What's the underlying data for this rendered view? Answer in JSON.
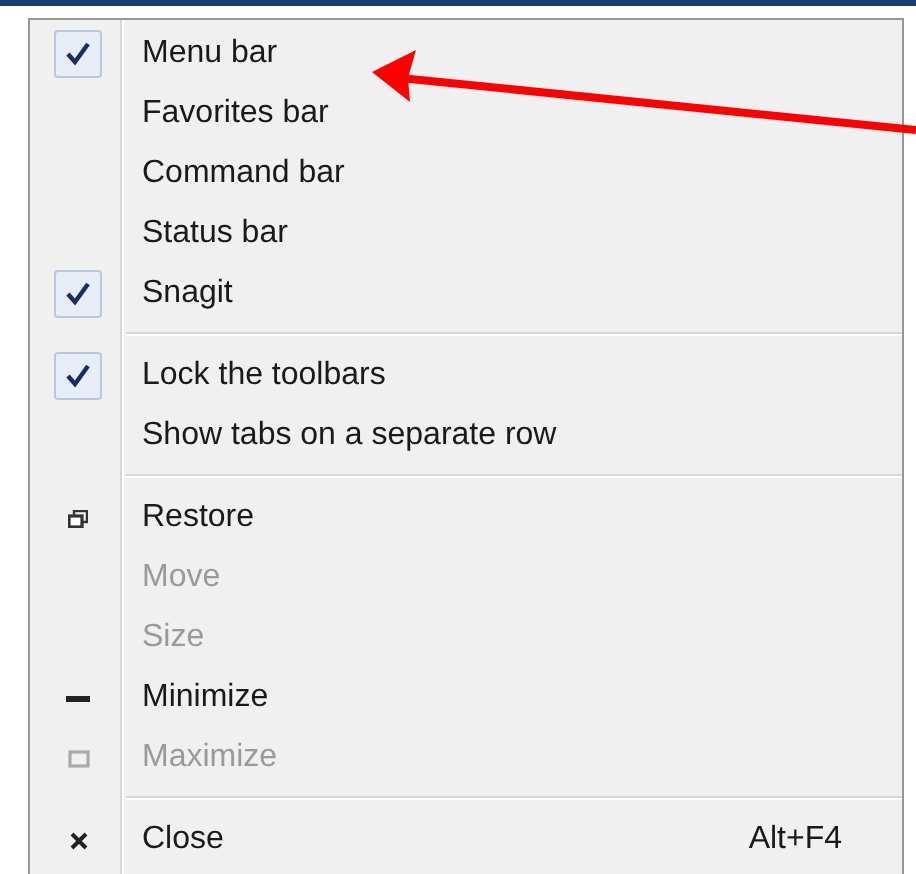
{
  "menu": {
    "sections": [
      {
        "items": [
          {
            "label": "Menu bar",
            "kind": "toggle",
            "checked": true,
            "disabled": false
          },
          {
            "label": "Favorites bar",
            "kind": "toggle",
            "checked": false,
            "disabled": false
          },
          {
            "label": "Command bar",
            "kind": "toggle",
            "checked": false,
            "disabled": false
          },
          {
            "label": "Status bar",
            "kind": "toggle",
            "checked": false,
            "disabled": false
          },
          {
            "label": "Snagit",
            "kind": "toggle",
            "checked": true,
            "disabled": false
          }
        ]
      },
      {
        "items": [
          {
            "label": "Lock the toolbars",
            "kind": "toggle",
            "checked": true,
            "disabled": false
          },
          {
            "label": "Show tabs on a separate row",
            "kind": "toggle",
            "checked": false,
            "disabled": false
          }
        ]
      },
      {
        "items": [
          {
            "label": "Restore",
            "kind": "restore",
            "disabled": false
          },
          {
            "label": "Move",
            "kind": "plain",
            "disabled": true
          },
          {
            "label": "Size",
            "kind": "plain",
            "disabled": true
          },
          {
            "label": "Minimize",
            "kind": "minimize",
            "disabled": false
          },
          {
            "label": "Maximize",
            "kind": "maximize",
            "disabled": true
          }
        ]
      },
      {
        "items": [
          {
            "label": "Close",
            "kind": "close",
            "disabled": false,
            "shortcut": "Alt+F4"
          }
        ]
      }
    ]
  }
}
